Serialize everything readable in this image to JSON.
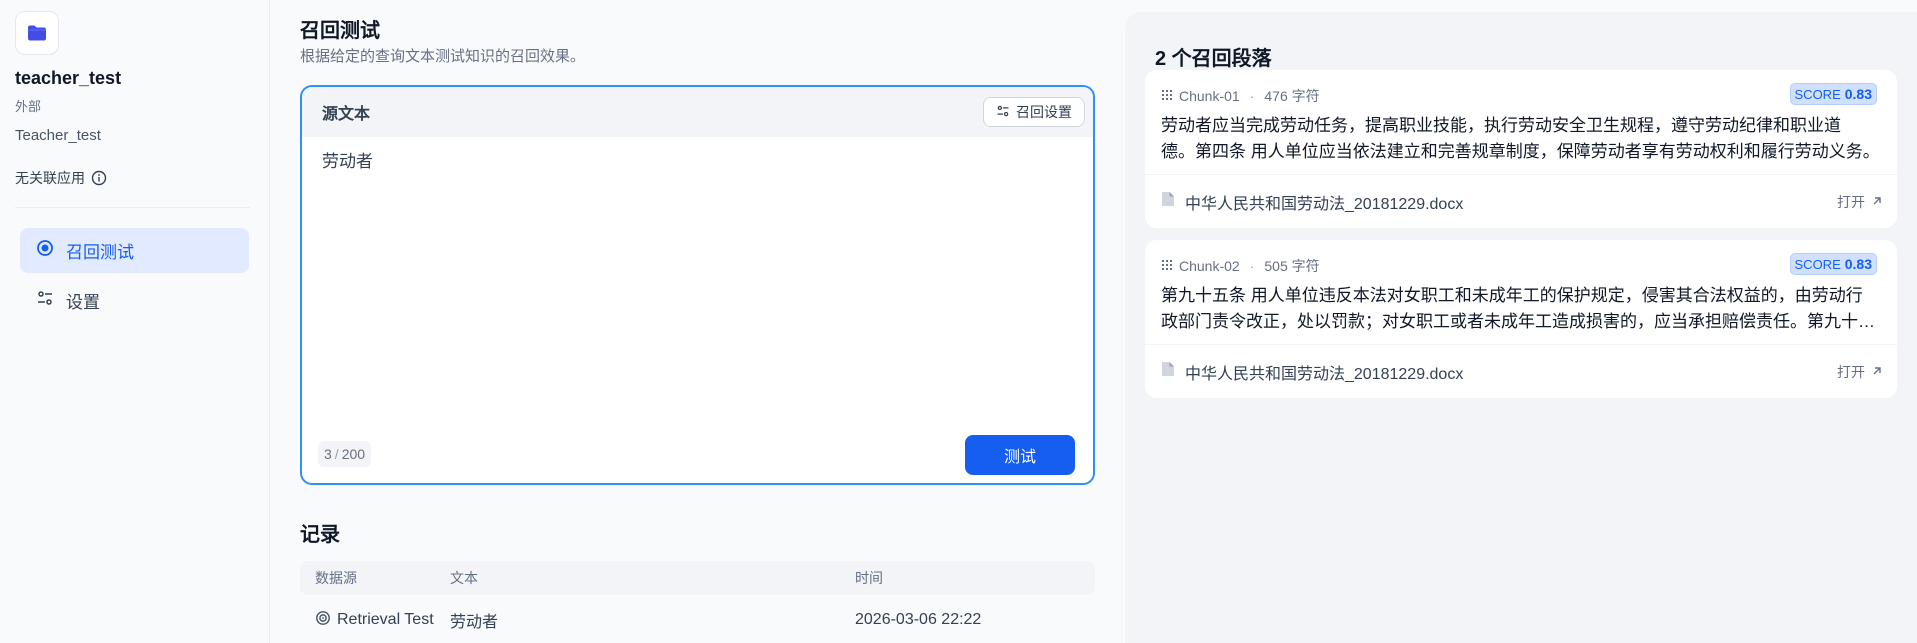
{
  "dataset": {
    "name": "teacher_test",
    "type": "外部",
    "description": "Teacher_test",
    "linked_apps": "无关联应用"
  },
  "nav": [
    {
      "label": "召回测试",
      "active": true
    },
    {
      "label": "设置",
      "active": false
    }
  ],
  "main": {
    "title": "召回测试",
    "subtitle": "根据给定的查询文本测试知识的召回效果。",
    "query": {
      "header": "源文本",
      "settings_label": "召回设置",
      "text": "劳动者",
      "count": "3",
      "max": "200",
      "test_label": "测试"
    },
    "records": {
      "title": "记录",
      "columns": [
        "数据源",
        "文本",
        "时间"
      ],
      "rows": [
        {
          "source": "Retrieval Test",
          "text": "劳动者",
          "time": "2026-03-06 22:22"
        }
      ]
    }
  },
  "results": {
    "title": "2 个召回段落",
    "chunks": [
      {
        "id": "Chunk-01",
        "chars": "476 字符",
        "score_label": "SCORE",
        "score": "0.83",
        "line1": "劳动者应当完成劳动任务，提高职业技能，执行劳动安全卫生规程，遵守劳动纪律和职业道",
        "line2": "德。第四条 用人单位应当依法建立和完善规章制度，保障劳动者享有劳动权利和履行劳动义务。",
        "doc": "中华人民共和国劳动法_20181229.docx",
        "open_label": "打开"
      },
      {
        "id": "Chunk-02",
        "chars": "505 字符",
        "score_label": "SCORE",
        "score": "0.83",
        "line1": "第九十五条 用人单位违反本法对女职工和未成年工的保护规定，侵害其合法权益的，由劳动行",
        "line2": "政部门责令改正，处以罚款；对女职工或者未成年工造成损害的，应当承担赔偿责任。第九十六条",
        "doc": "中华人民共和国劳动法_20181229.docx",
        "open_label": "打开"
      }
    ]
  },
  "colors": {
    "accent": "#155eef",
    "active_nav_bg": "#e1eaff",
    "focus_border": "#2e90fa",
    "score_bg": "#d1e0ff"
  }
}
